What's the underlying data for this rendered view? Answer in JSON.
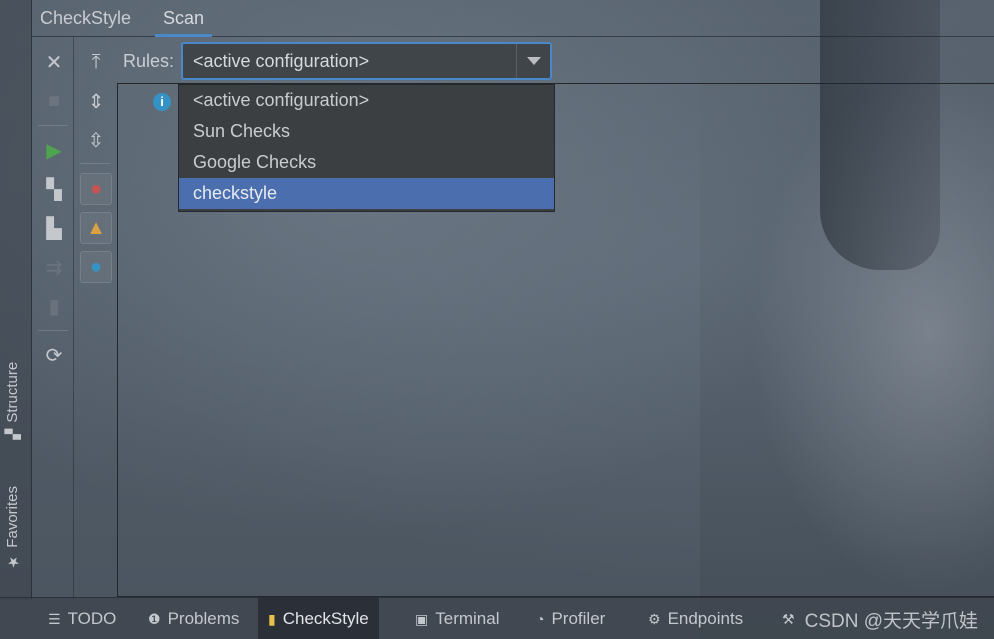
{
  "window": {
    "tabs": [
      {
        "label": "CheckStyle",
        "active": false
      },
      {
        "label": "Scan",
        "active": true
      }
    ]
  },
  "side_tabs": {
    "structure": {
      "label": "Structure",
      "icon": "structure-icon"
    },
    "favorites": {
      "label": "Favorites",
      "icon": "star-icon"
    }
  },
  "toolbar": {
    "close": "close-icon",
    "stop": "stop-icon",
    "run": "run-icon",
    "check_module": "module-icon",
    "check_project": "project-icon",
    "check_modified": "modified-icon",
    "check_dir": "directory-icon",
    "refresh": "refresh-icon",
    "scroll_top": "scroll-top-icon",
    "expand": "expand-all-icon",
    "collapse": "collapse-all-icon",
    "filter_error": "error-filter-icon",
    "filter_warning": "warning-filter-icon",
    "filter_info": "info-filter-icon"
  },
  "rules": {
    "label": "Rules:",
    "selected": "<active configuration>",
    "options": [
      "<active configuration>",
      "Sun Checks",
      "Google Checks",
      "checkstyle"
    ],
    "highlighted_index": 3
  },
  "bottom_tabs": [
    {
      "label": "TODO",
      "icon": "list-icon",
      "active": false
    },
    {
      "label": "Problems",
      "icon": "problems-icon",
      "active": false
    },
    {
      "label": "CheckStyle",
      "icon": "checkstyle-icon",
      "active": true
    },
    {
      "label": "Terminal",
      "icon": "terminal-icon",
      "active": false
    },
    {
      "label": "Profiler",
      "icon": "profiler-icon",
      "active": false
    },
    {
      "label": "Endpoints",
      "icon": "endpoints-icon",
      "active": false
    }
  ],
  "watermark": "CSDN @天天学爪娃",
  "colors": {
    "accent": "#4a88c7",
    "selection": "#4b6eaf",
    "popup_bg": "#3c3f41",
    "error": "#c75450",
    "warning": "#d9a343",
    "info": "#3592c4"
  }
}
